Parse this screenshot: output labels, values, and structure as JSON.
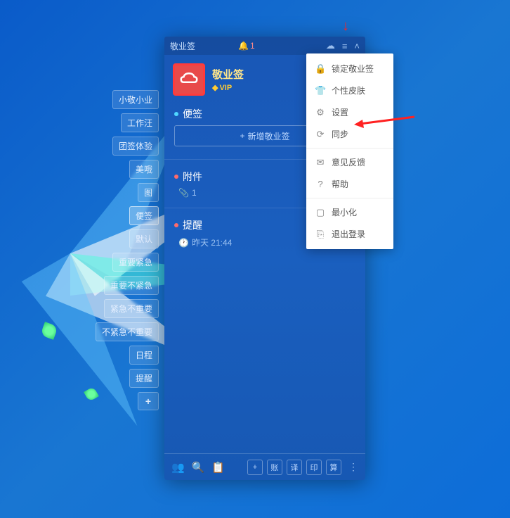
{
  "titlebar": {
    "title": "敬业签",
    "notification_count": "1"
  },
  "header": {
    "app_name": "敬业签",
    "vip_label": "VIP"
  },
  "sections": {
    "notes": {
      "title": "便签",
      "add_label": "新增敬业签"
    },
    "attachments": {
      "title": "附件",
      "count": "1"
    },
    "reminders": {
      "title": "提醒",
      "time": "昨天 21:44"
    }
  },
  "sidebar": {
    "tags": [
      "小敬小业",
      "工作汪",
      "团签体验",
      "美哦",
      "图",
      "便签",
      "默认",
      "重要紧急",
      "重要不紧急",
      "紧急不重要",
      "不紧急不重要",
      "日程",
      "提醒"
    ],
    "add": "+"
  },
  "menu": {
    "items": [
      {
        "icon": "lock",
        "label": "锁定敬业签"
      },
      {
        "icon": "skin",
        "label": "个性皮肤"
      },
      {
        "icon": "gear",
        "label": "设置"
      },
      {
        "icon": "sync",
        "label": "同步"
      },
      {
        "sep": true
      },
      {
        "icon": "feedback",
        "label": "意见反馈"
      },
      {
        "icon": "help",
        "label": "帮助"
      },
      {
        "sep": true
      },
      {
        "icon": "minimize",
        "label": "最小化"
      },
      {
        "icon": "logout",
        "label": "退出登录"
      }
    ]
  },
  "bottombar": {
    "buttons": [
      "账",
      "译",
      "印",
      "算"
    ]
  },
  "icon_glyphs": {
    "lock": "🔒",
    "skin": "👕",
    "gear": "⚙",
    "sync": "⟳",
    "feedback": "✉",
    "help": "?",
    "minimize": "▢",
    "logout": "⎘",
    "cloud": "☁",
    "menu": "≡",
    "chevron": "˄",
    "bell": "🔔",
    "clip": "📎",
    "clock": "🕐",
    "people": "👥",
    "search": "🔍",
    "calendar": "📋",
    "plus": "+",
    "dots": "⋮"
  }
}
